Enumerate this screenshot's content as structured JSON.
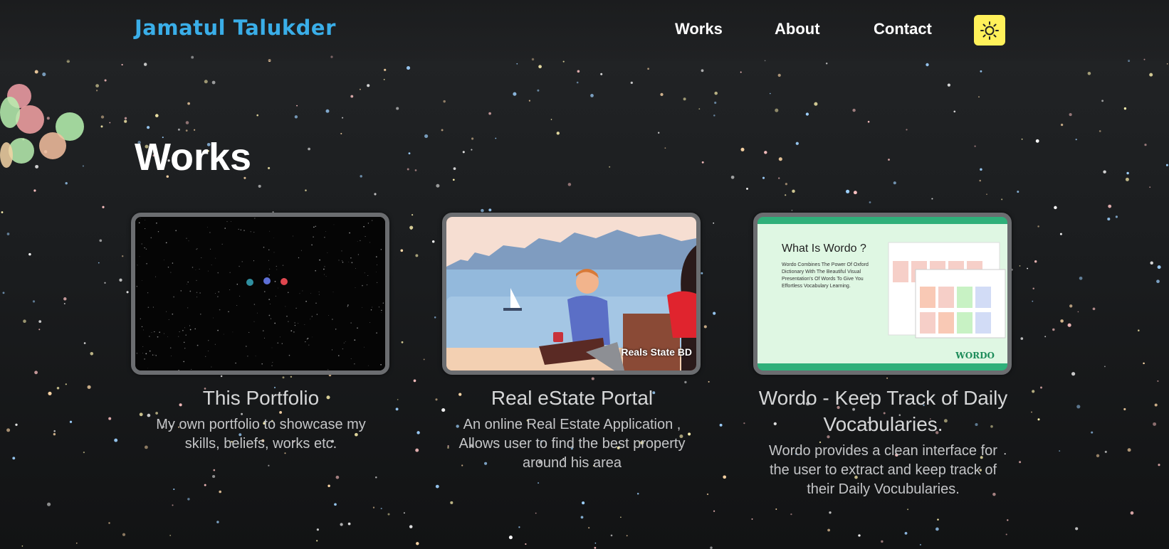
{
  "nav": {
    "brand": "Jamatul Talukder",
    "links": [
      "Works",
      "About",
      "Contact"
    ],
    "theme_icon": "sun-icon",
    "theme_color": "#fff15a"
  },
  "page": {
    "heading": "Works"
  },
  "projects": [
    {
      "title": "This Portfolio",
      "description": "My own portfolio to showcase my skills, beliefs, works etc."
    },
    {
      "title": "Real eState Portal",
      "description": "An online Real Estate Application , Allows user to find the best property around his area",
      "thumbnail_caption": "Reals State BD"
    },
    {
      "title": "Wordo - Keep Track of Daily Vocabularies.",
      "description": "Wordo provides a clean interface for the user to extract and keep track of their Daily Vocubularies.",
      "thumbnail_heading": "What Is Wordo ?",
      "thumbnail_text": "Wordo Combines The Power Of Oxford Dictionary With The Beautiful Visual Presentation's Of Words To Give You Effortless Vocabulary Learning.",
      "thumbnail_logo": "WORDO"
    }
  ],
  "colors": {
    "brand": "#3aaee8",
    "background": "#1b1d1f",
    "card_border": "#6b6d70",
    "wordo_green": "#2fb07a"
  }
}
